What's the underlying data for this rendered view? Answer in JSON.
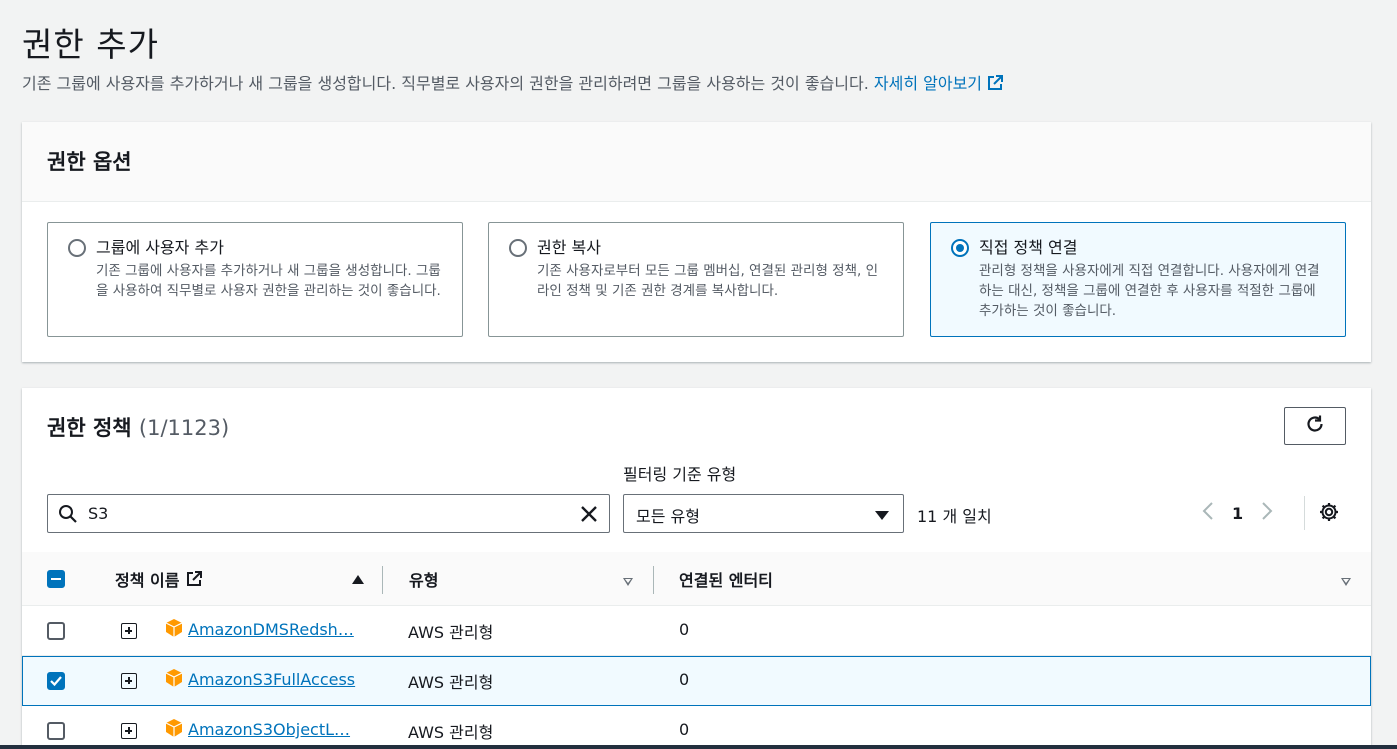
{
  "page": {
    "title": "권한 추가",
    "description": "기존 그룹에 사용자를 추가하거나 새 그룹을 생성합니다. 직무별로 사용자의 권한을 관리하려면 그룹을 사용하는 것이 좋습니다. ",
    "learn_more": "자세히 알아보기"
  },
  "options_panel": {
    "title": "권한 옵션",
    "options": [
      {
        "title": "그룹에 사용자 추가",
        "desc": "기존 그룹에 사용자를 추가하거나 새 그룹을 생성합니다. 그룹을 사용하여 직무별로 사용자 권한을 관리하는 것이 좋습니다.",
        "selected": false
      },
      {
        "title": "권한 복사",
        "desc": "기존 사용자로부터 모든 그룹 멤버십, 연결된 관리형 정책, 인라인 정책 및 기존 권한 경계를 복사합니다.",
        "selected": false
      },
      {
        "title": "직접 정책 연결",
        "desc": "관리형 정책을 사용자에게 직접 연결합니다. 사용자에게 연결하는 대신, 정책을 그룹에 연결한 후 사용자를 적절한 그룹에 추가하는 것이 좋습니다.",
        "selected": true
      }
    ]
  },
  "policies_panel": {
    "title": "권한 정책",
    "count": "(1/1123)",
    "filter_label": "필터링 기준 유형",
    "search_value": "S3",
    "type_select": "모든 유형",
    "matches": "11 개 일치",
    "page": "1",
    "columns": {
      "name": "정책 이름",
      "type": "유형",
      "entities": "연결된 엔터티"
    },
    "rows": [
      {
        "name": "AmazonDMSRedsh…",
        "type": "AWS 관리형",
        "entities": "0",
        "checked": false
      },
      {
        "name": "AmazonS3FullAccess",
        "type": "AWS 관리형",
        "entities": "0",
        "checked": true
      },
      {
        "name": "AmazonS3ObjectL…",
        "type": "AWS 관리형",
        "entities": "0",
        "checked": false
      }
    ]
  },
  "colors": {
    "link": "#0073bb",
    "selected_bg": "#f1faff",
    "cube": "#f90"
  }
}
